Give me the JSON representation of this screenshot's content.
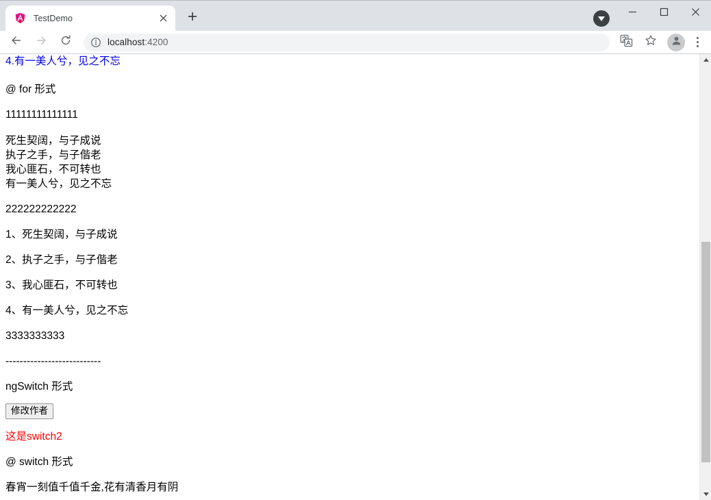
{
  "window": {
    "controls": {
      "minimize_label": "Minimize",
      "maximize_label": "Maximize",
      "close_label": "Close"
    },
    "download_badge_label": "Downloads"
  },
  "tab": {
    "title": "TestDemo",
    "favicon_name": "angular-logo-icon",
    "close_label": "Close tab",
    "newtab_label": "New tab"
  },
  "toolbar": {
    "back_label": "Back",
    "forward_label": "Forward",
    "reload_label": "Reload",
    "info_label": "View site information",
    "url_host": "localhost",
    "url_port": ":4200",
    "url_full": "localhost:4200",
    "translate_label": "Translate this page",
    "bookmark_label": "Bookmark this tab",
    "profile_label": "Profile",
    "menu_label": "Customize and control Google Chrome"
  },
  "content": {
    "top_blue_line": "4.有一美人兮，见之不忘",
    "for_heading": "@ for 形式",
    "ones": "11111111111111",
    "poem": [
      "死生契阔，与子成说",
      "执子之手，与子偕老",
      "我心匪石，不可转也",
      "有一美人兮，见之不忘"
    ],
    "twos": "222222222222",
    "numbered": [
      "1、死生契阔，与子成说",
      "2、执子之手，与子偕老",
      "3、我心匪石，不可转也",
      "4、有一美人兮，见之不忘"
    ],
    "threes": "3333333333",
    "divider": "---------------------------",
    "ngswitch_heading": "ngSwitch 形式",
    "change_author_button": "修改作者",
    "switch_result": "这是switch2",
    "switch_heading": "@ switch 形式",
    "switch_poem": "春宵一刻值千值千金,花有清香月有阴"
  },
  "colors": {
    "link_blue": "#0000ee",
    "alert_red": "#ff0000",
    "tabstrip_bg": "#dee1e6",
    "omnibox_bg": "#f1f3f4",
    "scrollbar_thumb": "#c1c1c1"
  },
  "scrollbar": {
    "up_arrow_label": "Scroll up",
    "down_arrow_label": "Scroll down",
    "thumb_label": "Vertical scroll thumb"
  }
}
